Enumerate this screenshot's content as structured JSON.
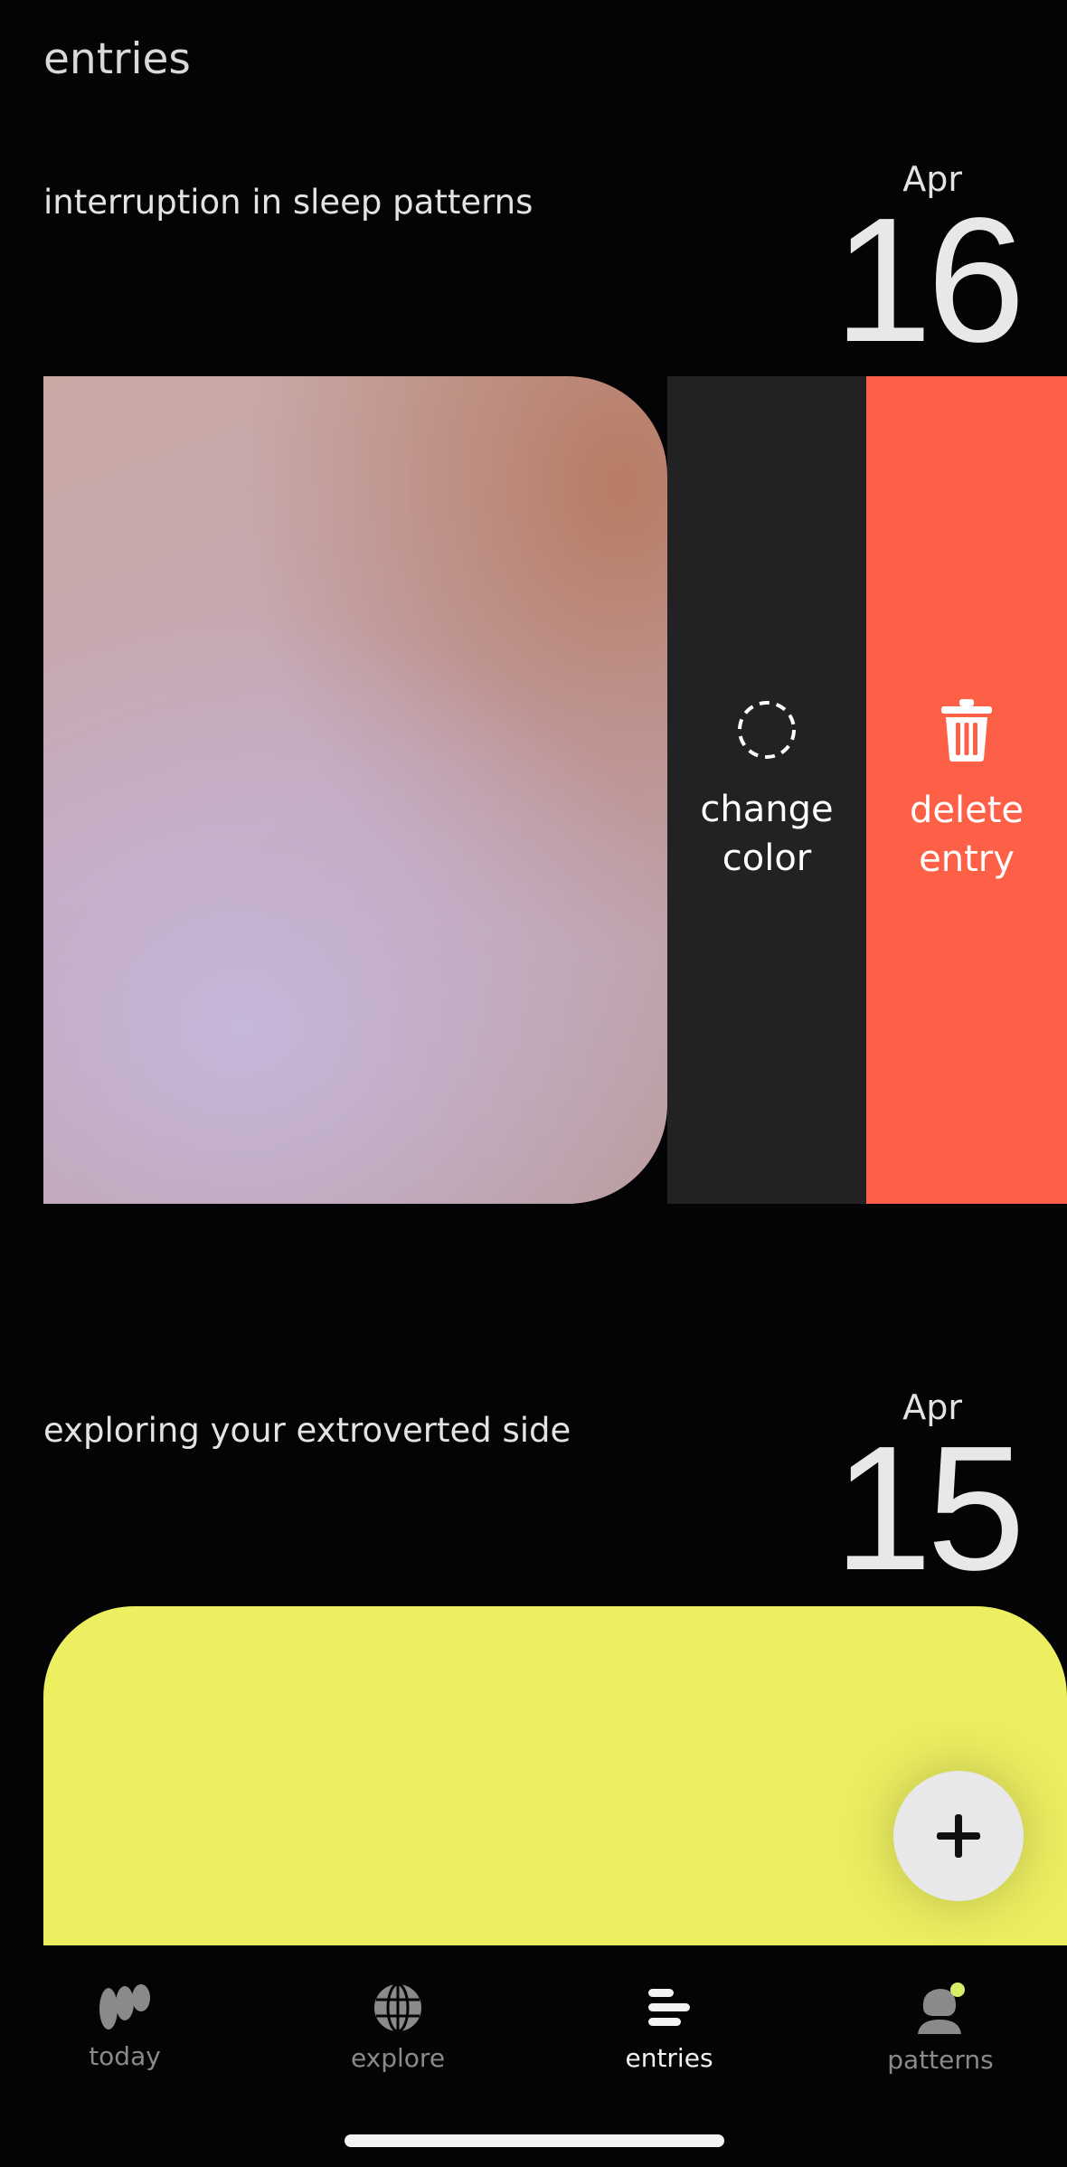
{
  "header": {
    "title": "entries"
  },
  "entries": [
    {
      "title": "interruption in sleep patterns",
      "month": "Apr",
      "day": "16",
      "card_color": "#c4aebf"
    },
    {
      "title": "exploring your extroverted side",
      "month": "Apr",
      "day": "15",
      "card_color": "#ecef60"
    }
  ],
  "swipe_actions": {
    "change_color": {
      "label": "change\ncolor",
      "icon": "dashed-circle-icon",
      "color": "#222124"
    },
    "delete_entry": {
      "label": "delete\nentry",
      "icon": "trash-icon",
      "color": "#fd6047"
    }
  },
  "fab": {
    "icon": "plus-icon"
  },
  "tabbar": {
    "items": [
      {
        "label": "today",
        "icon": "today-logo-icon",
        "active": false
      },
      {
        "label": "explore",
        "icon": "globe-icon",
        "active": false
      },
      {
        "label": "entries",
        "icon": "entries-lines-icon",
        "active": true
      },
      {
        "label": "patterns",
        "icon": "patterns-profile-icon",
        "active": false
      }
    ]
  }
}
